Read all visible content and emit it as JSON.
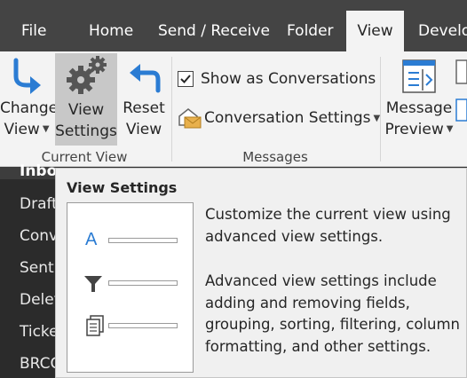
{
  "tabs": [
    "File",
    "Home",
    "Send / Receive",
    "Folder",
    "View",
    "Develo"
  ],
  "ribbon": {
    "change_view": {
      "line1": "Change",
      "line2": "View"
    },
    "view_settings": {
      "line1": "View",
      "line2": "Settings"
    },
    "reset_view": {
      "line1": "Reset",
      "line2": "View"
    },
    "current_view_label": "Current View",
    "show_as_conversations": "Show as Conversations",
    "conversation_settings": "Conversation Settings",
    "messages_label": "Messages",
    "message_preview": {
      "line1": "Message",
      "line2": "Preview"
    },
    "show_as_conversations_checked": true
  },
  "folders": [
    "Inbo",
    "Draft",
    "Conv",
    "Sent",
    "Delet",
    "Ticke",
    "BRCC"
  ],
  "tooltip": {
    "title": "View Settings",
    "para1": "Customize the current view using advanced view settings.",
    "para2": "Advanced view settings include adding and removing fields, grouping, sorting, filtering, column formatting, and other settings.",
    "image_letter": "A"
  },
  "colors": {
    "tabbar": "#444444",
    "ribbon": "#f3f3f3",
    "accent_blue": "#2b7cd3",
    "folder_pane": "#2b2b2b"
  }
}
